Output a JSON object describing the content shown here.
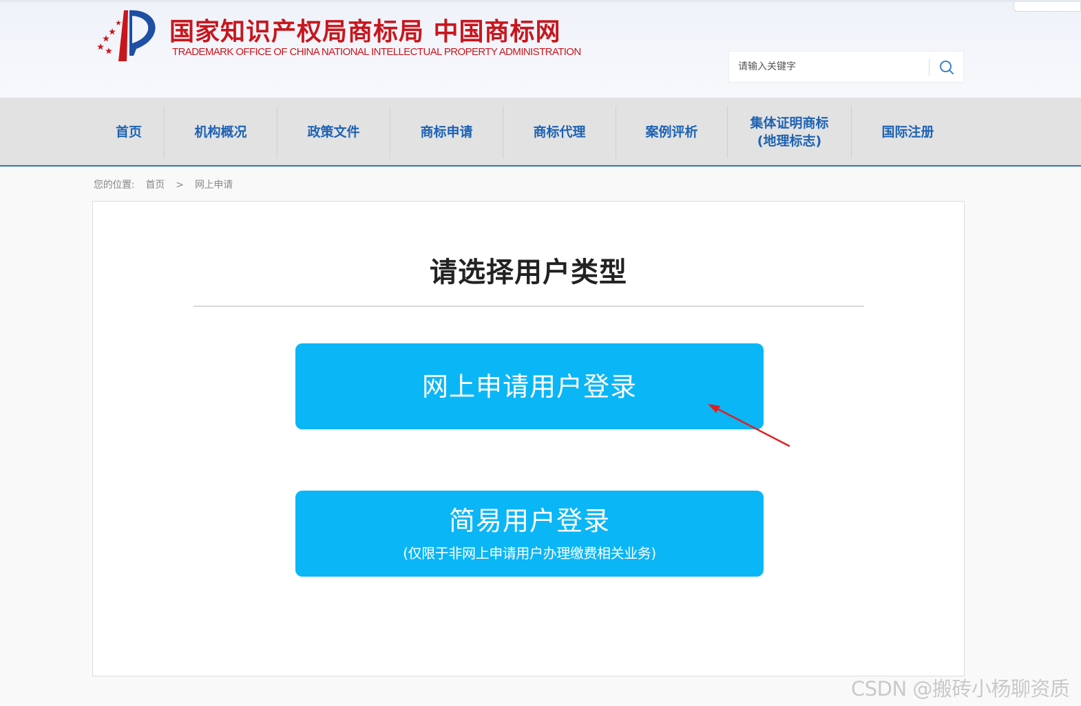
{
  "header": {
    "title": "国家知识产权局商标局 中国商标网",
    "subtitle": "TRADEMARK OFFICE OF CHINA NATIONAL INTELLECTUAL PROPERTY ADMINISTRATION",
    "search": {
      "placeholder": "请输入关键字",
      "value": ""
    }
  },
  "nav": {
    "items": [
      {
        "label": "首页"
      },
      {
        "label": "机构概况"
      },
      {
        "label": "政策文件"
      },
      {
        "label": "商标申请"
      },
      {
        "label": "商标代理"
      },
      {
        "label": "案例评析"
      },
      {
        "label": "集体证明商标\n(地理标志)"
      },
      {
        "label": "国际注册"
      }
    ]
  },
  "breadcrumb": {
    "prefix": "您的位置:",
    "home": "首页",
    "separator": ">",
    "current": "网上申请"
  },
  "main": {
    "title": "请选择用户类型",
    "online_login": {
      "label": "网上申请用户登录"
    },
    "simple_login": {
      "label": "简易用户登录",
      "note": "(仅限于非网上申请用户办理缴费相关业务)"
    }
  },
  "watermark": "CSDN @搬砖小杨聊资质",
  "colors": {
    "brand_red": "#c8161d",
    "nav_text": "#1d62b3",
    "button_blue": "#0ab6f6",
    "annotation_arrow": "#e02020"
  }
}
